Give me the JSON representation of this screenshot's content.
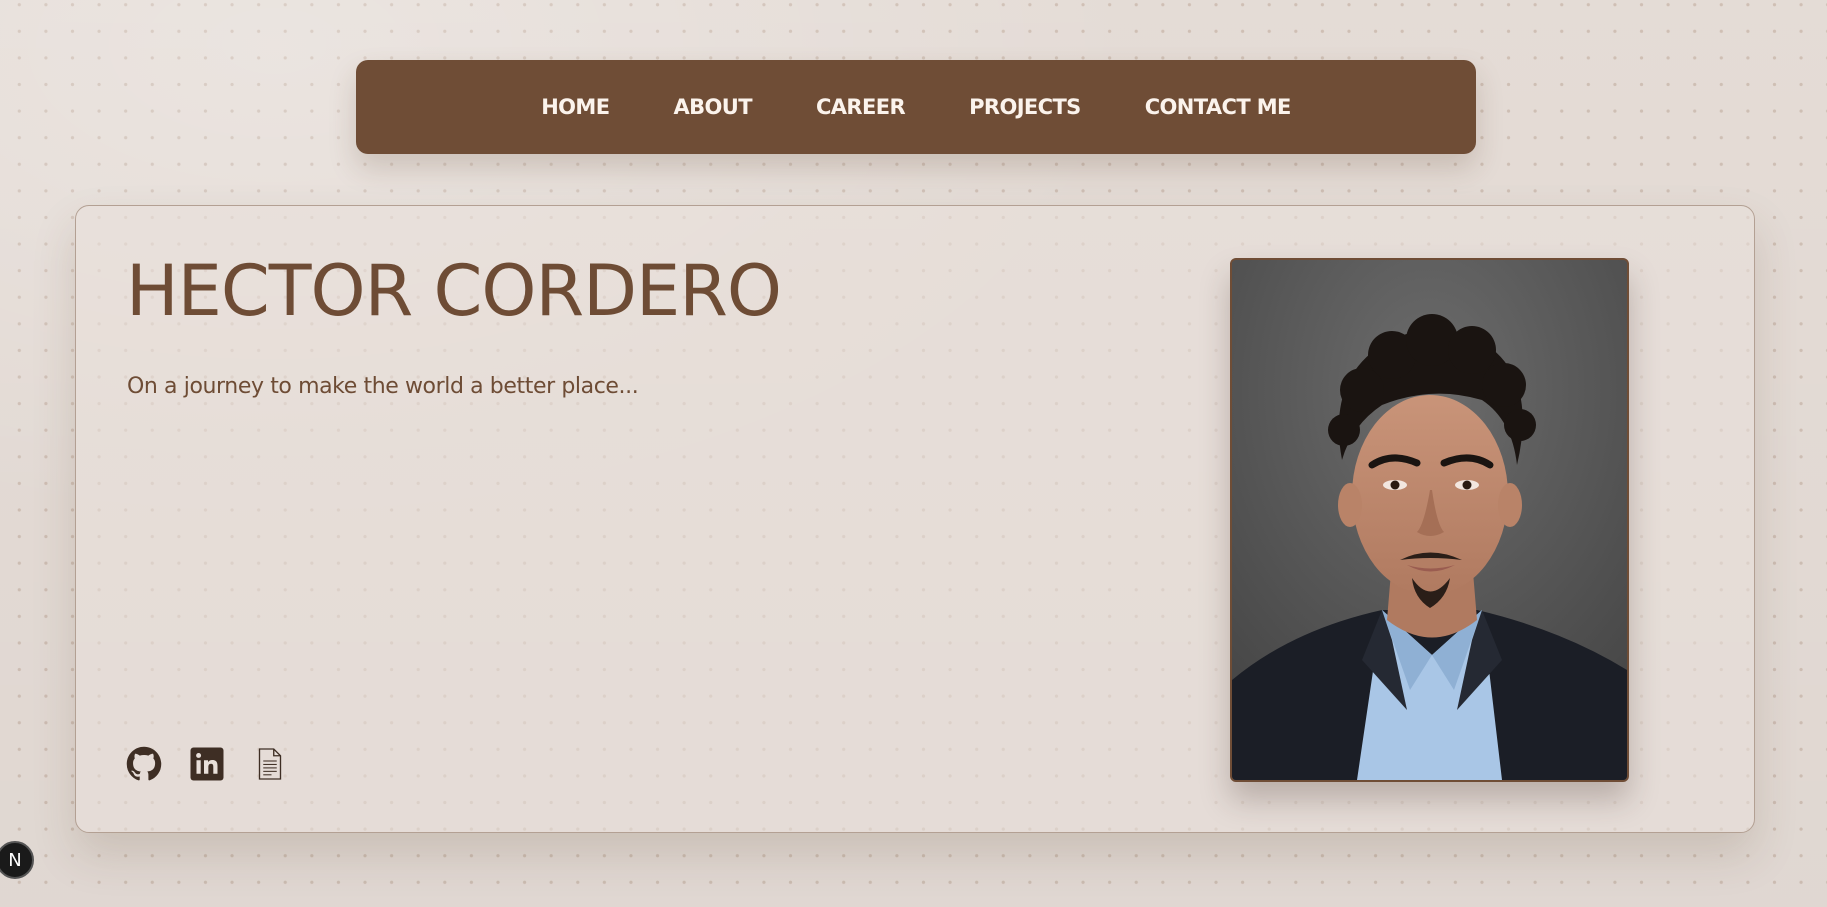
{
  "nav": {
    "items": [
      {
        "label": "HOME"
      },
      {
        "label": "ABOUT"
      },
      {
        "label": "CAREER"
      },
      {
        "label": "PROJECTS"
      },
      {
        "label": "CONTACT ME"
      }
    ]
  },
  "hero": {
    "name": "HECTOR CORDERO",
    "tagline": "On a journey to make the world a better place...",
    "socials": [
      {
        "icon": "github-icon"
      },
      {
        "icon": "linkedin-icon"
      },
      {
        "icon": "document-icon"
      }
    ],
    "photo": {
      "subject": "portrait-photo"
    }
  },
  "dev_badge": {
    "label": "N"
  },
  "colors": {
    "background": "#e9e0da",
    "accent": "#6f4d36",
    "nav_text": "#fbf3ec",
    "heading": "#6e4c35"
  }
}
